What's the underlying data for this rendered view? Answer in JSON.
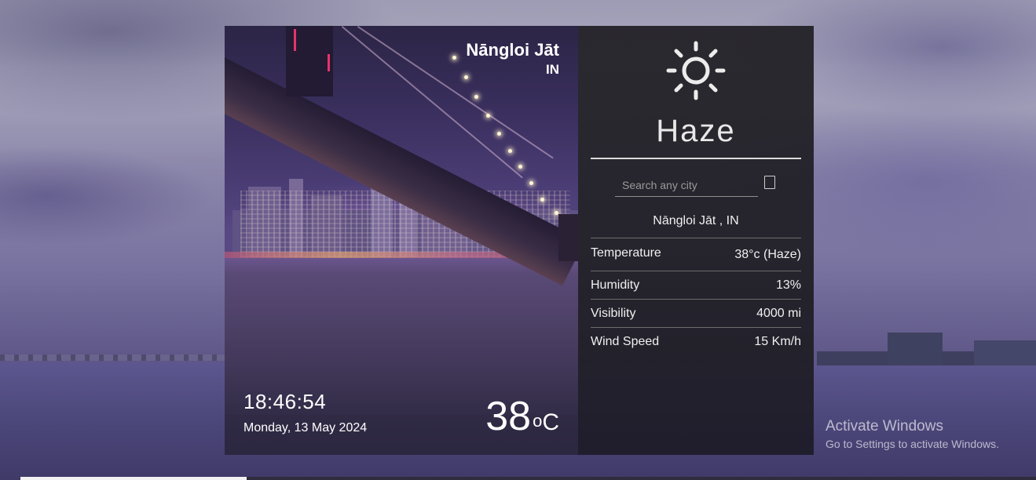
{
  "location": {
    "city": "Nāngloi Jāt",
    "country": "IN",
    "full": "Nāngloi Jāt , IN"
  },
  "time": {
    "clock": "18:46:54",
    "date": "Monday, 13 May 2024"
  },
  "current": {
    "temperature_value": "38",
    "degree_symbol": "o",
    "unit": "C",
    "condition": "Haze",
    "icon": "sun-icon"
  },
  "search": {
    "placeholder": "Search any city",
    "button_icon": "search-button-icon"
  },
  "details": [
    {
      "label": "Temperature",
      "value": "38°c (Haze)"
    },
    {
      "label": "Humidity",
      "value": "13%"
    },
    {
      "label": "Visibility",
      "value": "4000 mi"
    },
    {
      "label": "Wind Speed",
      "value": "15 Km/h"
    }
  ],
  "watermark": {
    "title": "Activate Windows",
    "subtitle": "Go to Settings to activate Windows."
  },
  "colors": {
    "panel_bg": "#222126",
    "text": "#ffffff",
    "accent_line": "#dcdcdc"
  }
}
